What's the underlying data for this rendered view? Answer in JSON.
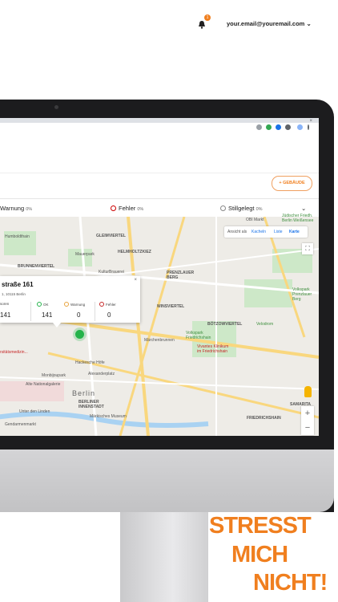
{
  "browser": {
    "close_glyph": "×"
  },
  "app": {
    "notification_count": "1",
    "user_email": "your.email@youremail.com",
    "email_chevron": "⌄",
    "add_building_label": "+ GEBÄUDE"
  },
  "status": {
    "warnung": {
      "label": "Warnung",
      "pct": "0%"
    },
    "fehler": {
      "label": "Fehler",
      "pct": "0%"
    },
    "stillgelegt": {
      "label": "Stillgelegt",
      "pct": "0%"
    },
    "chevron": "⌄"
  },
  "view_toggle": {
    "prefix": "Ansicht als",
    "kacheln": "Kacheln",
    "liste": "Liste",
    "karte": "Karte"
  },
  "popup": {
    "title": "straße 161",
    "address": "1, 10115 Berlin",
    "close": "×",
    "col_sensors": "soren",
    "val_sensors": "141",
    "col_ok": "OK",
    "val_ok": "141",
    "col_warnung": "Warnung",
    "val_warnung": "0",
    "col_fehler": "Fehler",
    "val_fehler": "0"
  },
  "map_labels": {
    "humboldthain": "Humboldthain",
    "gleimviertel": "GLEIMVIERTEL",
    "mauerpark": "Mauerpark",
    "brunnenviertel": "BRUNNENVIERTEL",
    "helmholtzkiez": "HELMHOLTZKIEZ",
    "kulturbrauerei": "KulturBrauerei",
    "prenzlauer_berg": "PRENZLAUER\nBERG",
    "winsviertel": "WINSVIERTEL",
    "bötzowviertel": "BÖTZOWVIERTEL",
    "obi": "OBI Markt",
    "juedischer_friedhof": "Jüdischer Friedh.\nBerlin Weißensee",
    "volkspark_fh": "Volkspark\nFriedrichshain",
    "velodrom": "Velodrom",
    "maerchenbrunnen": "Märchenbrunnen",
    "vivantes": "Vivantes Klinikum\nim Friedrichshain",
    "volkspark_prenzl": "Volkspark\nPrenzlauer\nBerg",
    "hackesche": "Hackesche Höfe",
    "monbijoupark": "Monbijoupark",
    "alexanderplatz": "Alexanderplatz",
    "nationalgalerie": "Alte Nationalgalerie",
    "berlin": "Berlin",
    "berliner_innenstadt": "BERLINER\nINNENSTADT",
    "unter_den_linden": "Unter den Linden",
    "maerkisches": "Märkisches Museum",
    "gendarmenmarkt": "Gendarmenmarkt",
    "friedrichshain": "FRIEDRICHSHAIN",
    "samarita": "SAMARITA",
    "charite": "rsitätsmedizin..."
  },
  "slogan": {
    "line1": "STRESST",
    "line2": "MICH",
    "line3": "NICHT!"
  },
  "colors": {
    "accent": "#f07f1f",
    "ok": "#24b34a",
    "warning": "#e8a33d",
    "error": "#c62828"
  }
}
